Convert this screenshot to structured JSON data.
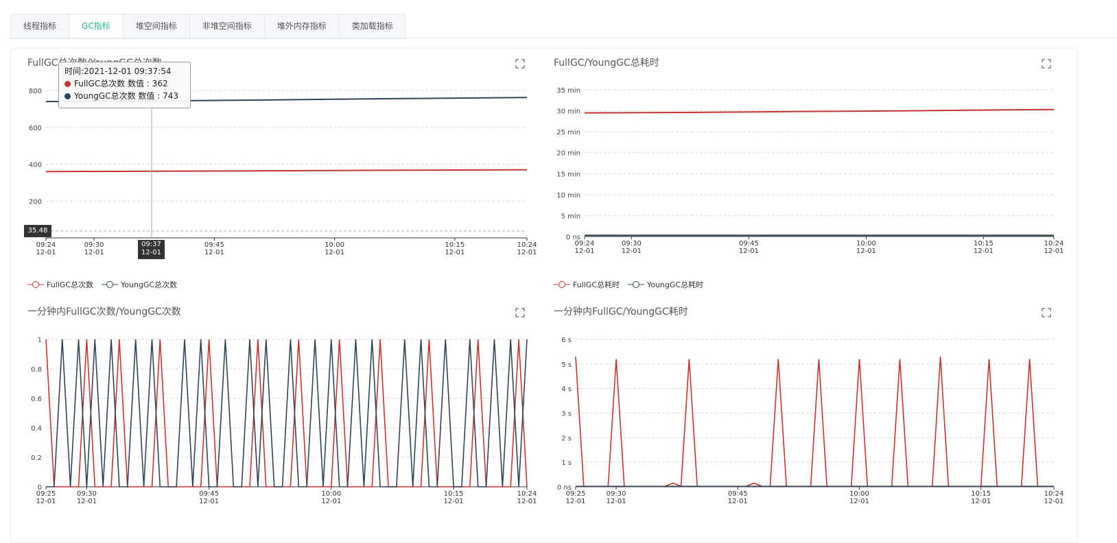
{
  "tabs": [
    {
      "label": "线程指标"
    },
    {
      "label": "GC指标",
      "active": true
    },
    {
      "label": "堆空间指标"
    },
    {
      "label": "非堆空间指标"
    },
    {
      "label": "堆外内存指标"
    },
    {
      "label": "类加载指标"
    }
  ],
  "colors": {
    "full": "#c23531",
    "young": "#2f4554",
    "accent": "#1fb888",
    "grid": "#d9d9d9"
  },
  "icons": {
    "expand": "fullscreen-expand-icon"
  },
  "tooltip": {
    "time": "时间:2021-12-01 09:37:54",
    "full": "FullGC总次数 数值 : 362",
    "young": "YoungGC总次数 数值 : 743",
    "x_label_time": "09:37",
    "x_label_date": "12-01",
    "y_label": "35.48"
  },
  "chart_data": [
    {
      "id": "tl",
      "type": "line",
      "title": "FullGC总次数/YoungGC总次数",
      "ylim": [
        0,
        800
      ],
      "yticks": [
        {
          "v": 0,
          "label": ""
        },
        {
          "v": 200,
          "label": "200"
        },
        {
          "v": 400,
          "label": "400"
        },
        {
          "v": 600,
          "label": "600"
        },
        {
          "v": 800,
          "label": "800"
        }
      ],
      "xlim": [
        "09:24",
        "10:24"
      ],
      "xticks": [
        "09:24",
        "09:30",
        "09:45",
        "10:00",
        "10:15",
        "10:24"
      ],
      "xdate": "12-01",
      "legend": [
        "FullGC总次数",
        "YoungGC总次数"
      ],
      "x": [
        "09:24",
        "09:37",
        "09:50",
        "10:05",
        "10:24"
      ],
      "series": [
        {
          "name": "FullGC总次数",
          "values": [
            360,
            362,
            364,
            367,
            370
          ]
        },
        {
          "name": "YoungGC总次数",
          "values": [
            740,
            743,
            748,
            755,
            762
          ]
        }
      ]
    },
    {
      "id": "tr",
      "type": "line",
      "title": "FullGC/YoungGC总耗时",
      "ylim": [
        0,
        35
      ],
      "yunit": "min",
      "yticks": [
        {
          "v": 0,
          "label": "0 ns"
        },
        {
          "v": 5,
          "label": "5 min"
        },
        {
          "v": 10,
          "label": "10 min"
        },
        {
          "v": 15,
          "label": "15 min"
        },
        {
          "v": 20,
          "label": "20 min"
        },
        {
          "v": 25,
          "label": "25 min"
        },
        {
          "v": 30,
          "label": "30 min"
        },
        {
          "v": 35,
          "label": "35 min"
        }
      ],
      "xlim": [
        "09:24",
        "10:24"
      ],
      "xticks": [
        "09:24",
        "09:30",
        "09:45",
        "10:00",
        "10:15",
        "10:24"
      ],
      "xdate": "12-01",
      "legend": [
        "FullGC总耗时",
        "YoungGC总耗时"
      ],
      "x": [
        "09:24",
        "09:37",
        "09:50",
        "10:05",
        "10:24"
      ],
      "series": [
        {
          "name": "FullGC总耗时",
          "values": [
            29.5,
            29.6,
            29.8,
            30.0,
            30.3
          ]
        },
        {
          "name": "YoungGC总耗时",
          "values": [
            0.3,
            0.3,
            0.3,
            0.3,
            0.3
          ]
        }
      ]
    },
    {
      "id": "bl",
      "type": "line",
      "title": "一分钟内FullGC次数/YoungGC次数",
      "ylim": [
        0,
        1
      ],
      "yticks": [
        {
          "v": 0,
          "label": "0"
        },
        {
          "v": 0.2,
          "label": "0.2"
        },
        {
          "v": 0.4,
          "label": "0.4"
        },
        {
          "v": 0.6,
          "label": "0.6"
        },
        {
          "v": 0.8,
          "label": "0.8"
        },
        {
          "v": 1,
          "label": "1"
        }
      ],
      "xlim": [
        "09:25",
        "10:24"
      ],
      "xticks": [
        "09:25",
        "09:30",
        "09:45",
        "10:00",
        "10:15",
        "10:24"
      ],
      "xdate": "12-01",
      "x_start": "09:25",
      "x_interval_min": 1,
      "series": [
        {
          "name": "FullGC次数",
          "values": [
            1,
            0,
            0,
            0,
            0,
            1,
            0,
            0,
            0,
            1,
            0,
            0,
            0,
            0,
            1,
            0,
            0,
            0,
            0,
            0,
            1,
            0,
            0,
            0,
            0,
            0,
            1,
            0,
            0,
            0,
            0,
            1,
            0,
            0,
            0,
            0,
            1,
            0,
            0,
            0,
            0,
            1,
            0,
            0,
            0,
            0,
            0,
            1,
            0,
            0,
            0,
            0,
            0,
            1,
            0,
            0,
            0,
            0,
            1,
            0
          ]
        },
        {
          "name": "YoungGC次数",
          "values": [
            0,
            0,
            1,
            0,
            1,
            0,
            1,
            0,
            1,
            0,
            0,
            1,
            0,
            1,
            0,
            0,
            0,
            1,
            0,
            1,
            0,
            0,
            1,
            0,
            0,
            1,
            0,
            1,
            0,
            0,
            1,
            0,
            0,
            1,
            0,
            1,
            0,
            0,
            1,
            0,
            1,
            0,
            0,
            0,
            1,
            0,
            1,
            0,
            0,
            1,
            0,
            0,
            1,
            0,
            0,
            1,
            0,
            1,
            0,
            1
          ]
        }
      ]
    },
    {
      "id": "br",
      "type": "line",
      "title": "一分钟内FullGC/YoungGC耗时",
      "ylim": [
        0,
        6
      ],
      "yunit": "s",
      "yticks": [
        {
          "v": 0,
          "label": "0 ns"
        },
        {
          "v": 1,
          "label": "1 s"
        },
        {
          "v": 2,
          "label": "2 s"
        },
        {
          "v": 3,
          "label": "3 s"
        },
        {
          "v": 4,
          "label": "4 s"
        },
        {
          "v": 5,
          "label": "5 s"
        },
        {
          "v": 6,
          "label": "6 s"
        }
      ],
      "xlim": [
        "09:25",
        "10:24"
      ],
      "xticks": [
        "09:25",
        "09:30",
        "09:45",
        "10:00",
        "10:15",
        "10:24"
      ],
      "xdate": "12-01",
      "x_start": "09:25",
      "x_interval_min": 1,
      "series": [
        {
          "name": "FullGC耗时",
          "values": [
            5.3,
            0.02,
            0.02,
            0.02,
            0.02,
            5.2,
            0.02,
            0.02,
            0.02,
            0.02,
            0.02,
            0.02,
            0.15,
            0.02,
            5.2,
            0.02,
            0.02,
            0.02,
            0.02,
            0.02,
            0.02,
            0.02,
            0.15,
            0.02,
            0.02,
            5.2,
            0.02,
            0.02,
            0.02,
            0.02,
            5.2,
            0.02,
            0.02,
            0.02,
            0.02,
            5.2,
            0.02,
            0.02,
            0.02,
            0.02,
            5.2,
            0.02,
            0.02,
            0.02,
            0.02,
            5.3,
            0.02,
            0.02,
            0.02,
            0.02,
            0.02,
            5.2,
            0.02,
            0.02,
            0.02,
            0.02,
            5.2,
            0.02,
            0.02,
            0.02
          ]
        },
        {
          "name": "YoungGC耗时",
          "values": [
            0.02,
            0.02,
            0.02,
            0.02,
            0.02,
            0.02,
            0.02,
            0.02,
            0.02,
            0.02,
            0.02,
            0.02,
            0.02,
            0.02,
            0.02,
            0.02,
            0.02,
            0.02,
            0.02,
            0.02,
            0.02,
            0.02,
            0.02,
            0.02,
            0.02,
            0.02,
            0.02,
            0.02,
            0.02,
            0.02,
            0.02,
            0.02,
            0.02,
            0.02,
            0.02,
            0.02,
            0.02,
            0.02,
            0.02,
            0.02,
            0.02,
            0.02,
            0.02,
            0.02,
            0.02,
            0.02,
            0.02,
            0.02,
            0.02,
            0.02,
            0.02,
            0.02,
            0.02,
            0.02,
            0.02,
            0.02,
            0.02,
            0.02,
            0.02,
            0.02
          ]
        }
      ]
    }
  ]
}
